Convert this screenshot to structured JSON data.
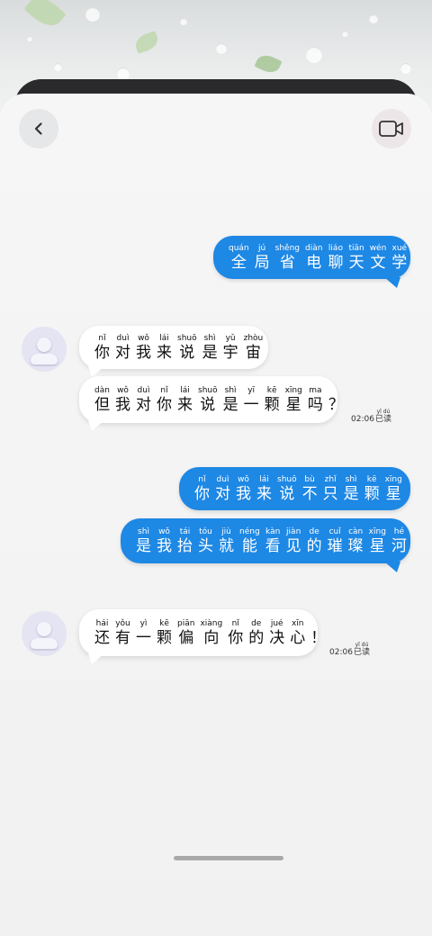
{
  "header": {
    "back_icon": "chevron-left-icon",
    "video_icon": "video-camera-icon"
  },
  "messages": [
    {
      "id": "m1",
      "side": "right",
      "style": "blue",
      "chars": [
        {
          "py": "quán",
          "hz": "全"
        },
        {
          "py": "jú",
          "hz": "局"
        },
        {
          "py": "shěng",
          "hz": "省"
        },
        {
          "py": "diàn",
          "hz": "电"
        },
        {
          "py": "liáo",
          "hz": "聊"
        },
        {
          "py": "tiān",
          "hz": "天"
        },
        {
          "py": "wén",
          "hz": "文"
        },
        {
          "py": "xué",
          "hz": "学"
        }
      ]
    },
    {
      "id": "m2",
      "side": "left",
      "style": "white",
      "chars": [
        {
          "py": "nǐ",
          "hz": "你"
        },
        {
          "py": "duì",
          "hz": "对"
        },
        {
          "py": "wǒ",
          "hz": "我"
        },
        {
          "py": "lái",
          "hz": "来"
        },
        {
          "py": "shuō",
          "hz": "说"
        },
        {
          "py": "shì",
          "hz": "是"
        },
        {
          "py": "yǔ",
          "hz": "宇"
        },
        {
          "py": "zhòu",
          "hz": "宙"
        }
      ]
    },
    {
      "id": "m3",
      "side": "left",
      "style": "white",
      "chars": [
        {
          "py": "dàn",
          "hz": "但"
        },
        {
          "py": "wǒ",
          "hz": "我"
        },
        {
          "py": "duì",
          "hz": "对"
        },
        {
          "py": "nǐ",
          "hz": "你"
        },
        {
          "py": "lái",
          "hz": "来"
        },
        {
          "py": "shuō",
          "hz": "说"
        },
        {
          "py": "shì",
          "hz": "是"
        },
        {
          "py": "yī",
          "hz": "一"
        },
        {
          "py": "kē",
          "hz": "颗"
        },
        {
          "py": "xīng",
          "hz": "星"
        },
        {
          "py": "ma",
          "hz": "吗"
        },
        {
          "py": "",
          "hz": "？"
        }
      ],
      "time": "02:06",
      "status": {
        "py": "yǐ dú",
        "hz": "已读"
      }
    },
    {
      "id": "m4",
      "side": "right",
      "style": "blue",
      "chars": [
        {
          "py": "nǐ",
          "hz": "你"
        },
        {
          "py": "duì",
          "hz": "对"
        },
        {
          "py": "wǒ",
          "hz": "我"
        },
        {
          "py": "lái",
          "hz": "来"
        },
        {
          "py": "shuō",
          "hz": "说"
        },
        {
          "py": "bù",
          "hz": "不"
        },
        {
          "py": "zhǐ",
          "hz": "只"
        },
        {
          "py": "shì",
          "hz": "是"
        },
        {
          "py": "kē",
          "hz": "颗"
        },
        {
          "py": "xīng",
          "hz": "星"
        }
      ]
    },
    {
      "id": "m5",
      "side": "right",
      "style": "blue",
      "chars": [
        {
          "py": "shì",
          "hz": "是"
        },
        {
          "py": "wǒ",
          "hz": "我"
        },
        {
          "py": "tái",
          "hz": "抬"
        },
        {
          "py": "tóu",
          "hz": "头"
        },
        {
          "py": "jiù",
          "hz": "就"
        },
        {
          "py": "néng",
          "hz": "能"
        },
        {
          "py": "kàn",
          "hz": "看"
        },
        {
          "py": "jiàn",
          "hz": "见"
        },
        {
          "py": "de",
          "hz": "的"
        },
        {
          "py": "cuǐ",
          "hz": "璀"
        },
        {
          "py": "càn",
          "hz": "璨"
        },
        {
          "py": "xīng",
          "hz": "星"
        },
        {
          "py": "hé",
          "hz": "河"
        }
      ]
    },
    {
      "id": "m6",
      "side": "left",
      "style": "white",
      "chars": [
        {
          "py": "hái",
          "hz": "还"
        },
        {
          "py": "yǒu",
          "hz": "有"
        },
        {
          "py": "yì",
          "hz": "一"
        },
        {
          "py": "kē",
          "hz": "颗"
        },
        {
          "py": "piān",
          "hz": "偏"
        },
        {
          "py": "xiàng",
          "hz": "向"
        },
        {
          "py": "nǐ",
          "hz": "你"
        },
        {
          "py": "de",
          "hz": "的"
        },
        {
          "py": "jué",
          "hz": "决"
        },
        {
          "py": "xīn",
          "hz": "心"
        },
        {
          "py": "",
          "hz": "！"
        }
      ],
      "time": "02:06",
      "status": {
        "py": "yǐ dú",
        "hz": "已读"
      }
    }
  ],
  "colors": {
    "bubble_blue": "#1e88e5",
    "bubble_white": "#ffffff",
    "sheet": "#f3f3f3",
    "back_card": "#2a2a2c"
  }
}
